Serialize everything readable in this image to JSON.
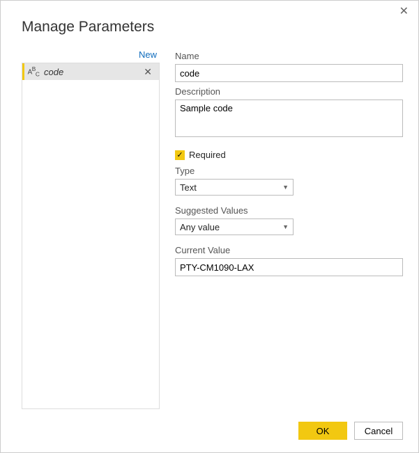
{
  "dialog": {
    "title": "Manage Parameters",
    "new_link": "New"
  },
  "param_list": {
    "items": [
      {
        "icon": "abc-icon",
        "name": "code"
      }
    ]
  },
  "labels": {
    "name": "Name",
    "description": "Description",
    "required": "Required",
    "type": "Type",
    "suggested_values": "Suggested Values",
    "current_value": "Current Value"
  },
  "fields": {
    "name": "code",
    "description": "Sample code",
    "required": true,
    "type": "Text",
    "suggested_values": "Any value",
    "current_value": "PTY-CM1090-LAX"
  },
  "buttons": {
    "ok": "OK",
    "cancel": "Cancel"
  }
}
